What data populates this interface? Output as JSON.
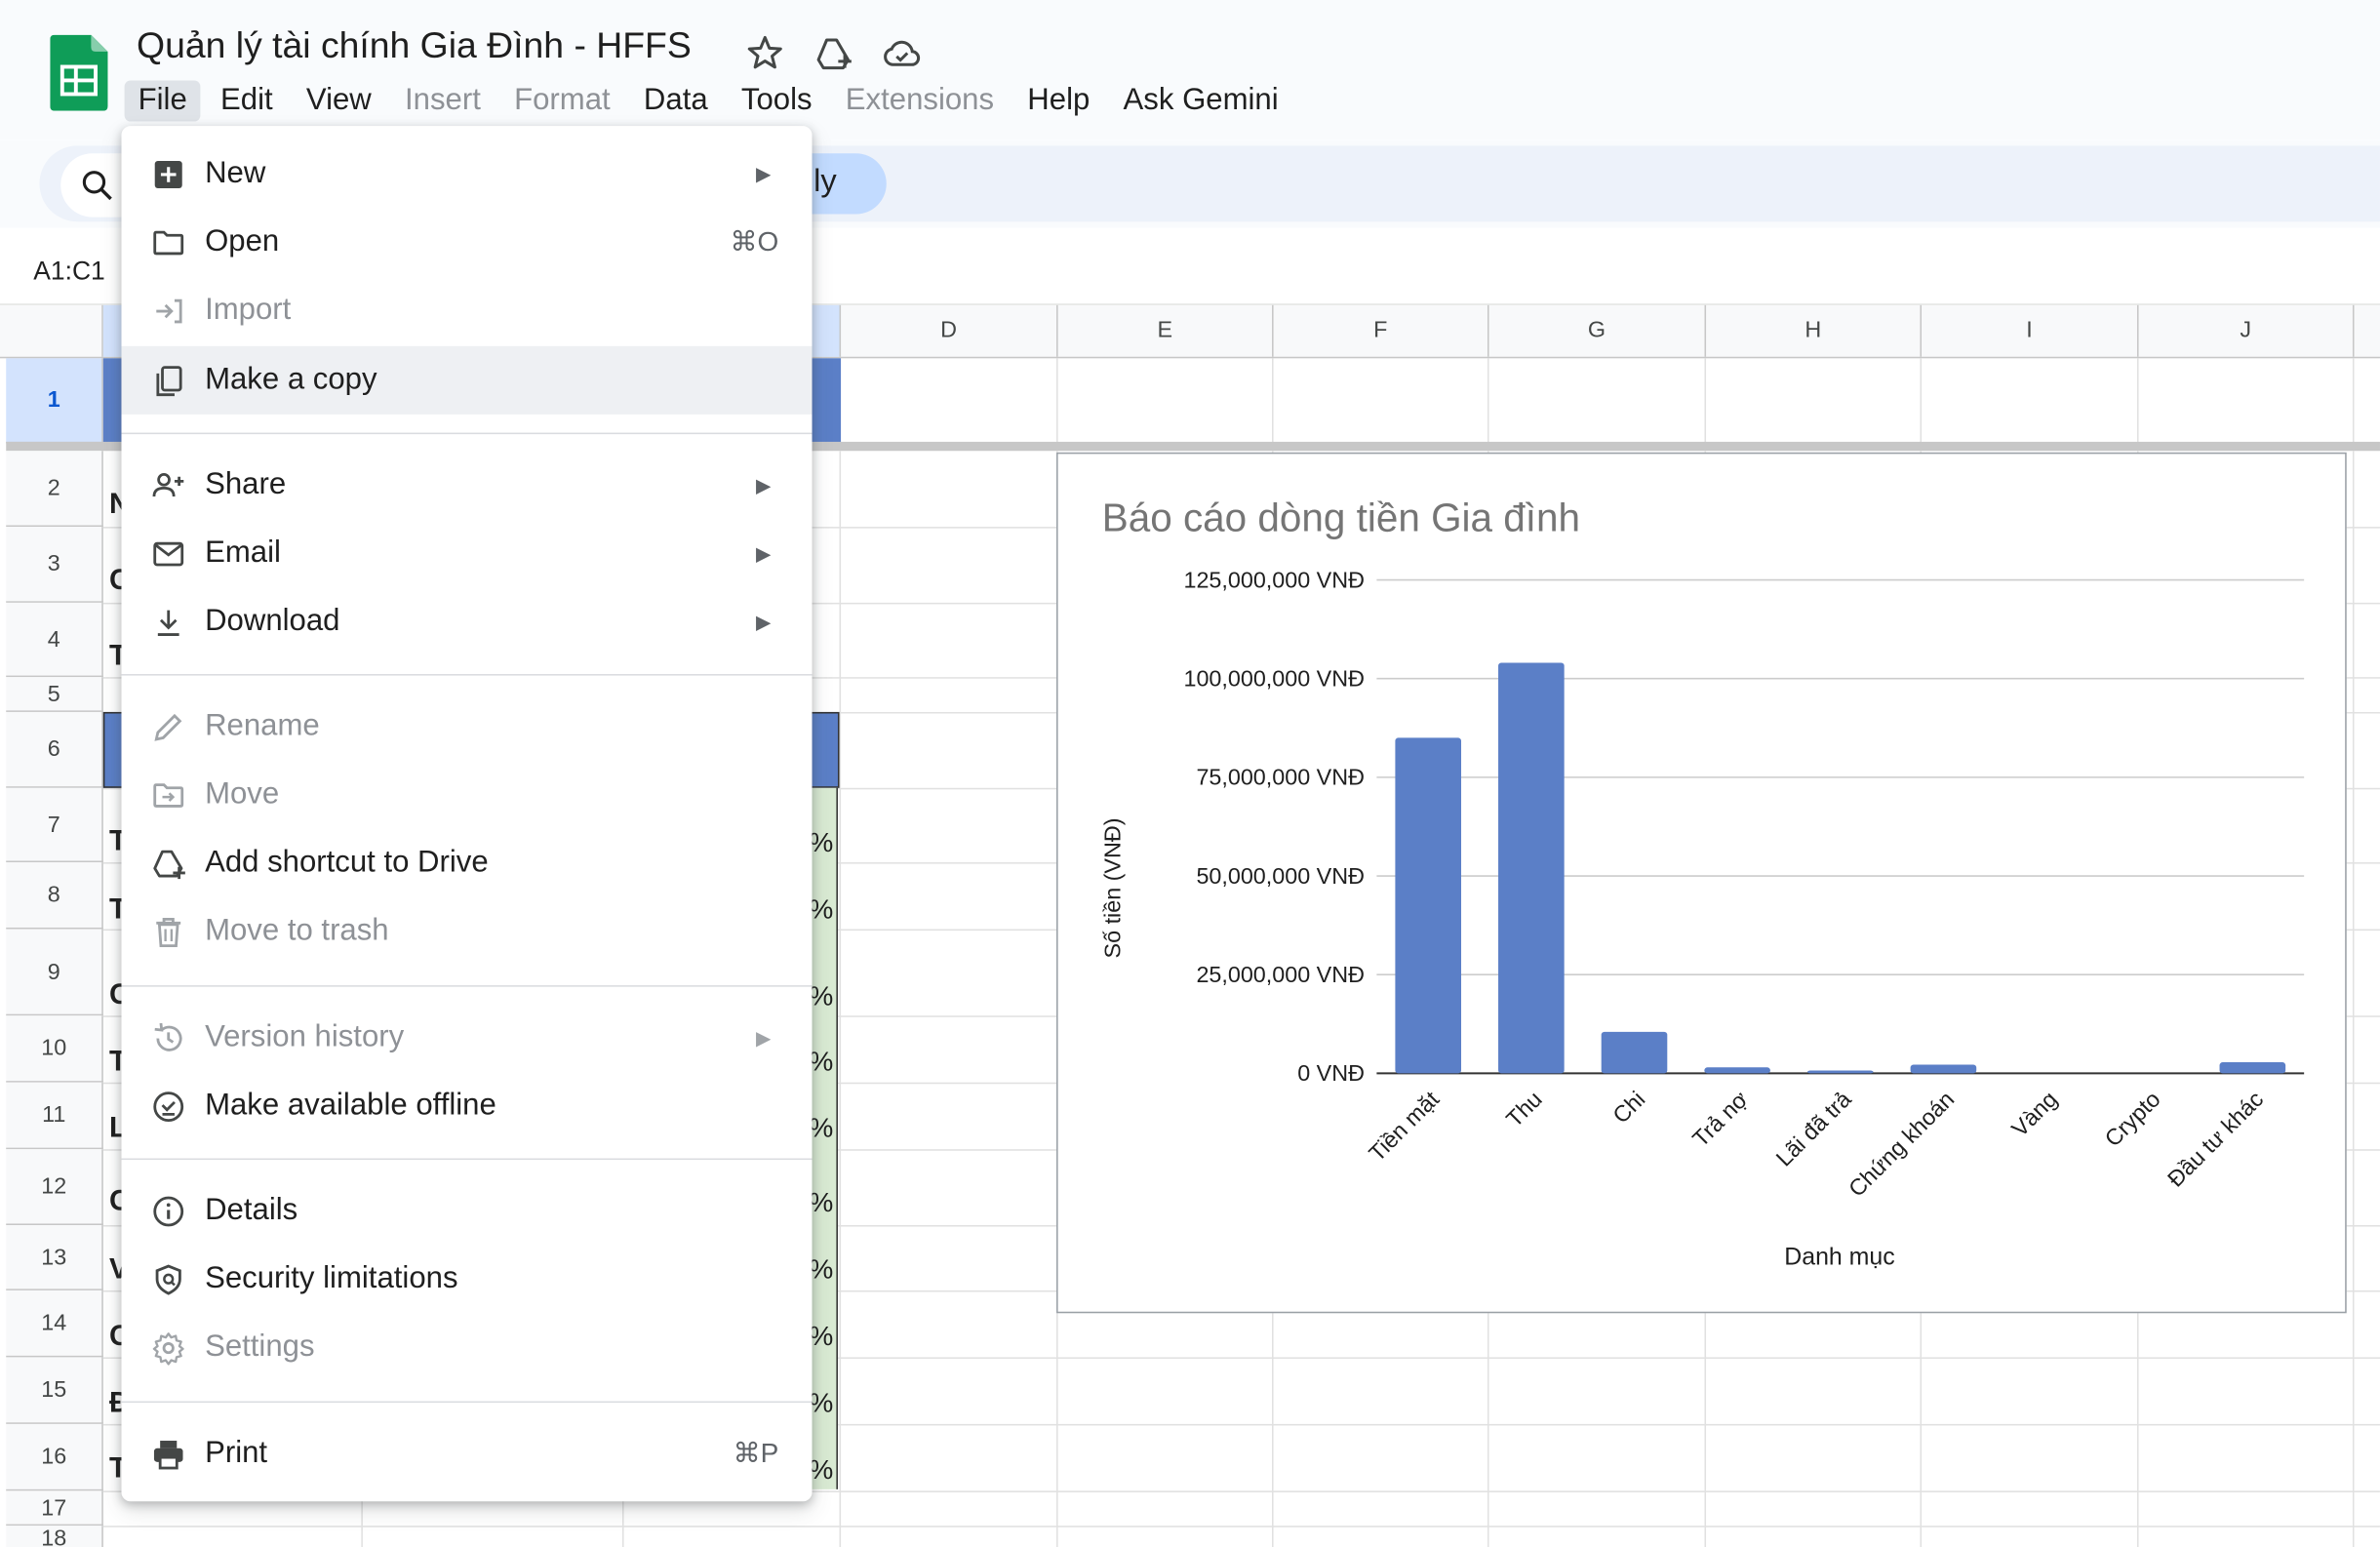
{
  "document": {
    "title": "Quản lý tài chính Gia Đình - HFFS"
  },
  "menubar": {
    "items": [
      {
        "label": "File",
        "enabled": true,
        "active": true
      },
      {
        "label": "Edit",
        "enabled": true
      },
      {
        "label": "View",
        "enabled": true
      },
      {
        "label": "Insert",
        "enabled": false
      },
      {
        "label": "Format",
        "enabled": false
      },
      {
        "label": "Data",
        "enabled": true
      },
      {
        "label": "Tools",
        "enabled": true
      },
      {
        "label": "Extensions",
        "enabled": false
      },
      {
        "label": "Help",
        "enabled": true
      },
      {
        "label": "Ask Gemini",
        "enabled": true
      }
    ]
  },
  "toolbar": {
    "mode_fragment": "ly"
  },
  "formula_bar": {
    "name_box": "A1:C1"
  },
  "grid": {
    "columns": [
      "D",
      "E",
      "F",
      "G",
      "H",
      "I",
      "J"
    ],
    "rows": [
      "1",
      "2",
      "3",
      "4",
      "5",
      "6",
      "7",
      "8",
      "9",
      "10",
      "11",
      "12",
      "13",
      "14",
      "15",
      "16",
      "17",
      "18"
    ],
    "col_a_fragments": [
      "N",
      "C",
      "T",
      "T",
      "T",
      "C",
      "T",
      "L",
      "C",
      "V",
      "C",
      "Đ",
      "T"
    ],
    "pct_fragment": "%"
  },
  "file_menu": {
    "groups": [
      [
        {
          "label": "New",
          "icon": "new-sheet-icon",
          "enabled": true,
          "submenu": true
        },
        {
          "label": "Open",
          "icon": "folder-icon",
          "enabled": true,
          "shortcut": "⌘O"
        },
        {
          "label": "Import",
          "icon": "import-icon",
          "enabled": false
        },
        {
          "label": "Make a copy",
          "icon": "copy-icon",
          "enabled": true,
          "hover": true
        }
      ],
      [
        {
          "label": "Share",
          "icon": "share-person-icon",
          "enabled": true,
          "submenu": true
        },
        {
          "label": "Email",
          "icon": "email-icon",
          "enabled": true,
          "submenu": true
        },
        {
          "label": "Download",
          "icon": "download-icon",
          "enabled": true,
          "submenu": true
        }
      ],
      [
        {
          "label": "Rename",
          "icon": "pencil-icon",
          "enabled": false
        },
        {
          "label": "Move",
          "icon": "move-folder-icon",
          "enabled": false
        },
        {
          "label": "Add shortcut to Drive",
          "icon": "drive-shortcut-icon",
          "enabled": true
        },
        {
          "label": "Move to trash",
          "icon": "trash-icon",
          "enabled": false
        }
      ],
      [
        {
          "label": "Version history",
          "icon": "history-icon",
          "enabled": false,
          "submenu": true
        },
        {
          "label": "Make available offline",
          "icon": "offline-icon",
          "enabled": true
        }
      ],
      [
        {
          "label": "Details",
          "icon": "info-icon",
          "enabled": true
        },
        {
          "label": "Security limitations",
          "icon": "shield-icon",
          "enabled": true
        },
        {
          "label": "Settings",
          "icon": "gear-icon",
          "enabled": false
        }
      ],
      [
        {
          "label": "Print",
          "icon": "printer-icon",
          "enabled": true,
          "shortcut": "⌘P"
        }
      ]
    ]
  },
  "colors": {
    "bar": "#5b7fc7",
    "selection": "#5b7fc7",
    "green_fill": "#d9ead3",
    "header_bg": "#f9fbfd",
    "disabled_text": "#8e9196"
  },
  "chart_data": {
    "type": "bar",
    "title": "Báo cáo dòng tiền Gia đình",
    "xlabel": "Danh mục",
    "ylabel": "Số tiền (VNĐ)",
    "categories": [
      "Tiền mặt",
      "Thu",
      "Chi",
      "Trả nợ",
      "Lãi đã trả",
      "Chứng khoán",
      "Vàng",
      "Crypto",
      "Đầu tư khác"
    ],
    "values": [
      85000000,
      104000000,
      10500000,
      1500000,
      700000,
      2200000,
      0,
      0,
      2800000
    ],
    "ylim": [
      0,
      125000000
    ],
    "yticks": [
      0,
      25000000,
      50000000,
      75000000,
      100000000,
      125000000
    ],
    "ytick_labels": [
      "0 VNĐ",
      "25,000,000 VNĐ",
      "50,000,000 VNĐ",
      "75,000,000 VNĐ",
      "100,000,000 VNĐ",
      "125,000,000 VNĐ"
    ],
    "grid": true,
    "legend": "none"
  }
}
